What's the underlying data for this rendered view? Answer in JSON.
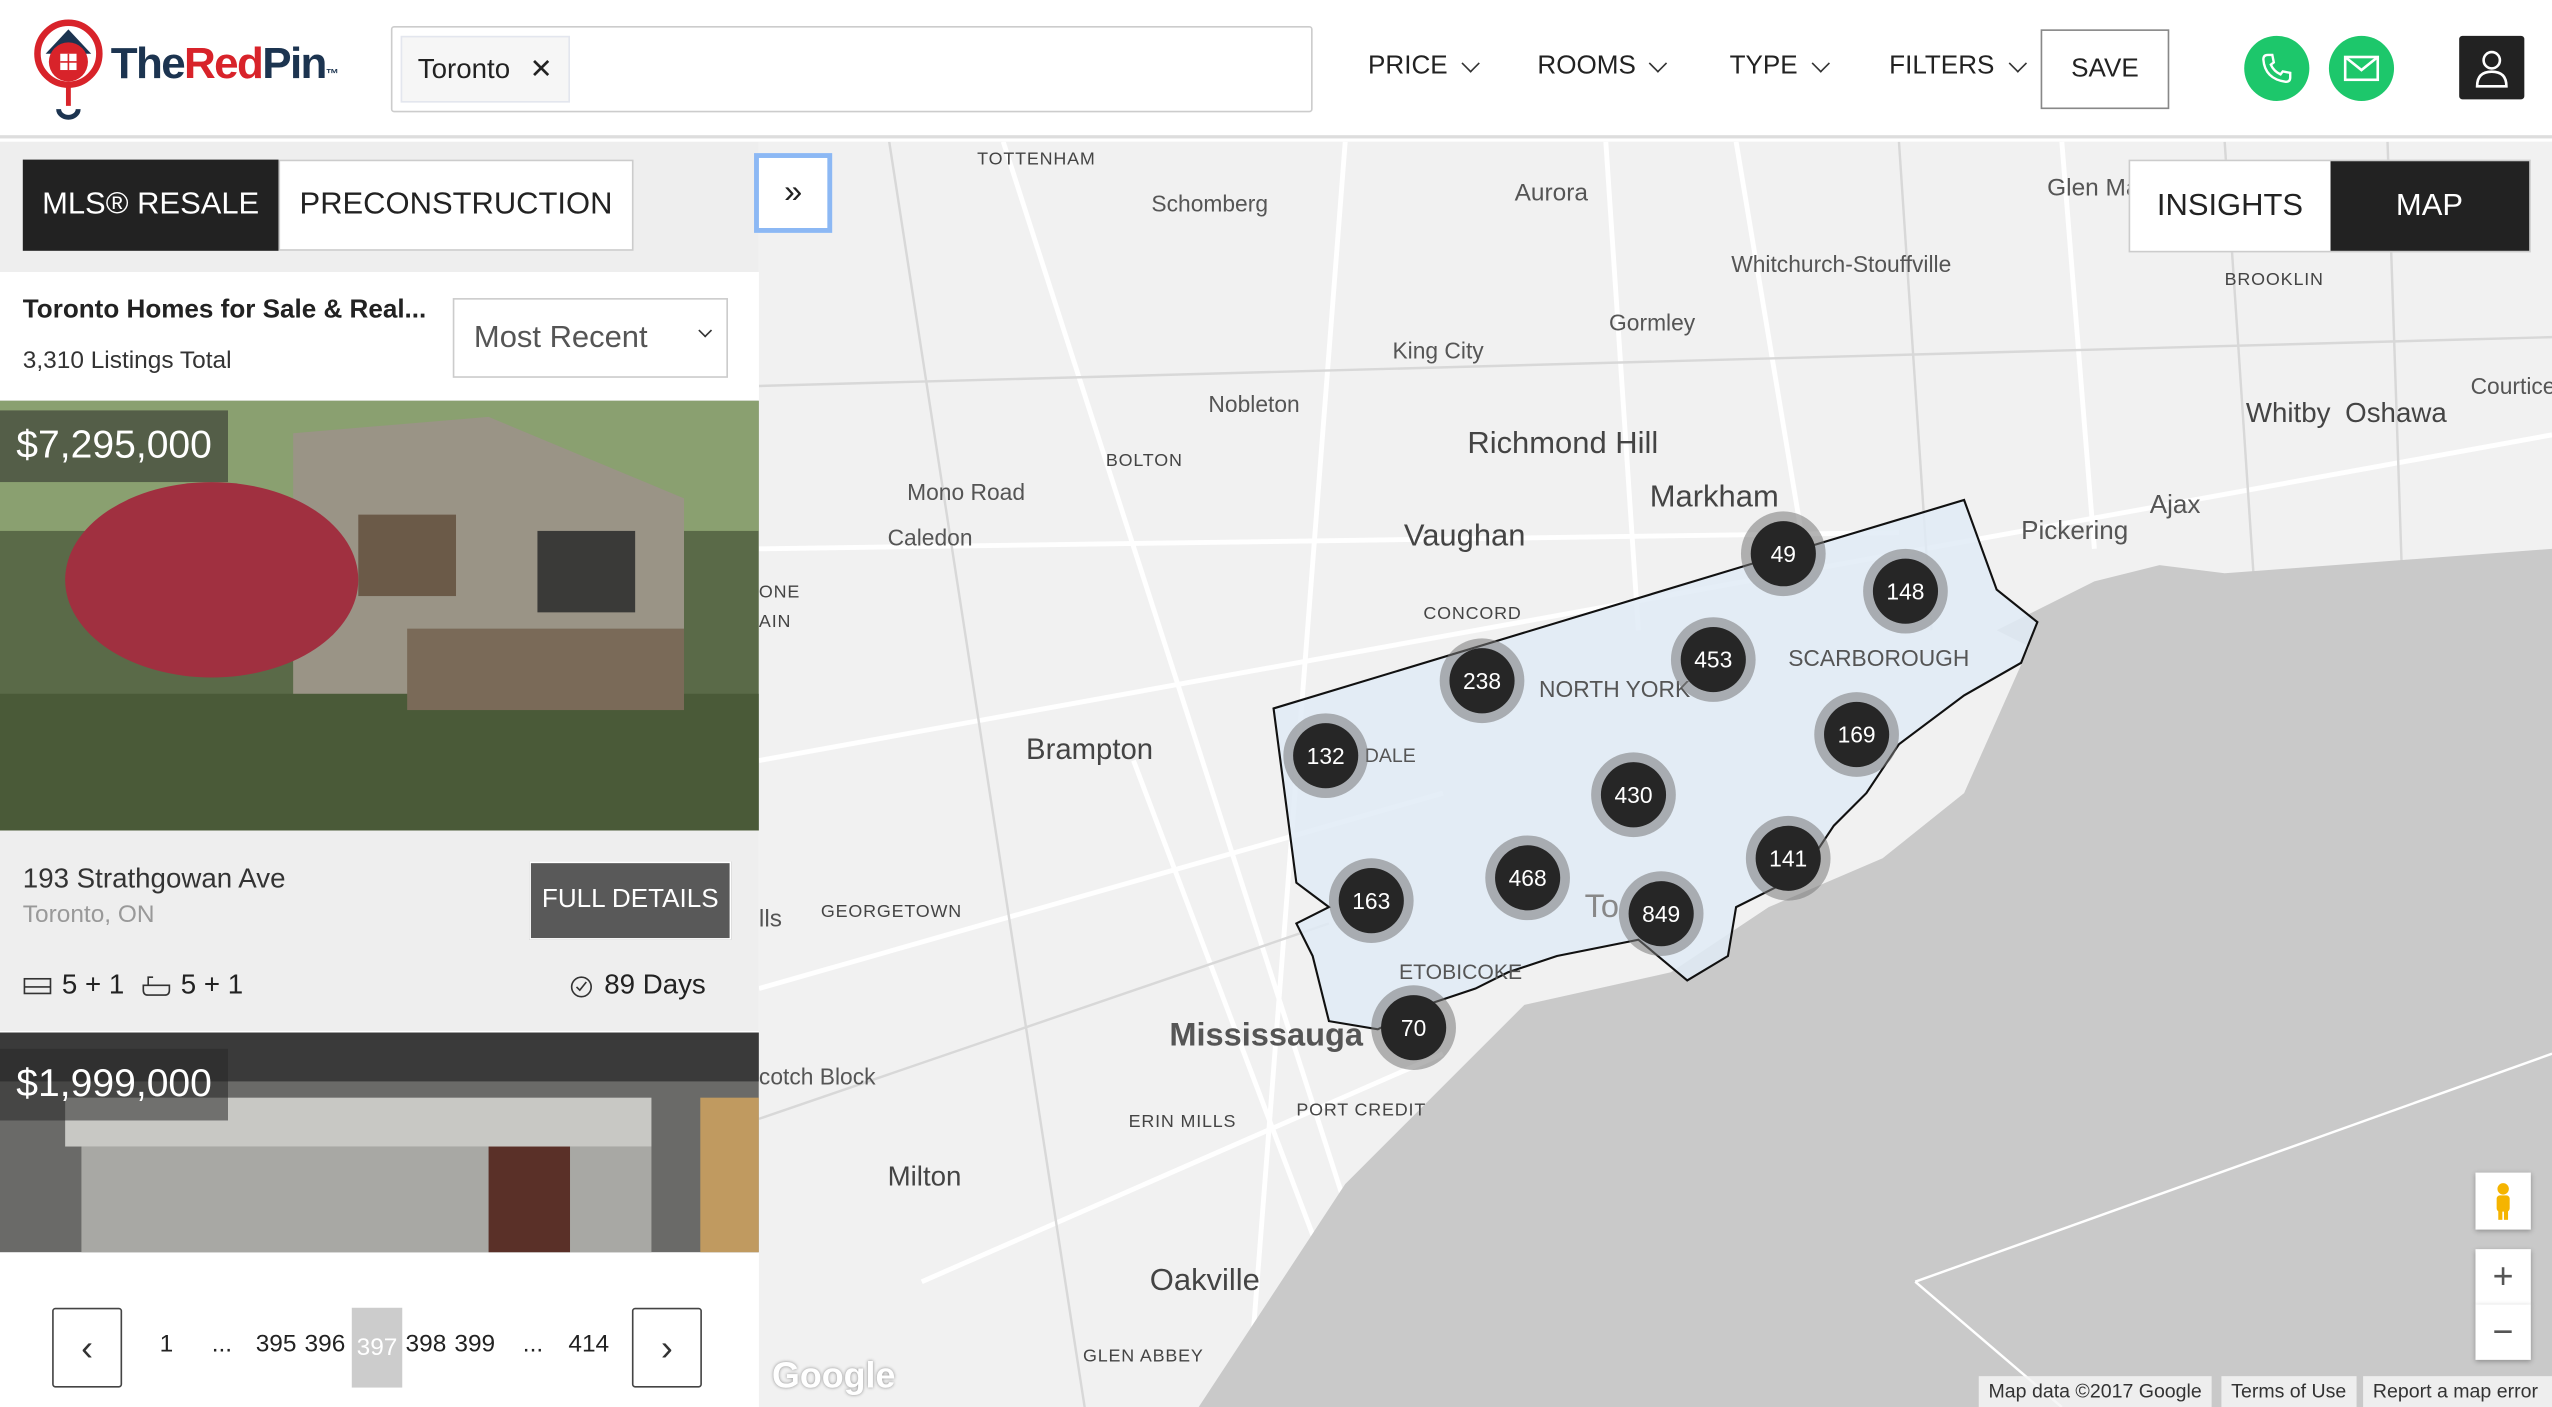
{
  "brand": {
    "logo_text_dark_1": "The",
    "logo_text_red": "Red",
    "logo_text_dark_2": "Pin",
    "trademark": "™"
  },
  "search": {
    "chip_label": "Toronto",
    "chip_remove": "✕"
  },
  "nav": {
    "price": "PRICE",
    "rooms": "ROOMS",
    "type": "TYPE",
    "filters": "FILTERS",
    "save": "SAVE"
  },
  "colors": {
    "brand_red": "#d8232a",
    "brand_navy": "#1c3450",
    "contact_green": "#1dc76b",
    "toronto_fill": "#e1ebf6"
  },
  "listing_tabs": {
    "resale": "MLS® RESALE",
    "preconstruction": "PRECONSTRUCTION",
    "active": "resale"
  },
  "results": {
    "title": "Toronto Homes for Sale & Real...",
    "count": "3,310 Listings Total",
    "sort_selected": "Most Recent"
  },
  "listings": [
    {
      "price": "$7,295,000",
      "address": "193 Strathgowan Ave",
      "city": "Toronto, ON",
      "beds": "5 + 1",
      "baths": "5 + 1",
      "days": "89 Days",
      "details_button": "FULL DETAILS"
    },
    {
      "price": "$1,999,000"
    }
  ],
  "pagination": {
    "pages": [
      "1",
      "...",
      "395",
      "396",
      "397",
      "398",
      "399",
      "...",
      "414"
    ],
    "current": "397",
    "prev": "‹",
    "next": "›"
  },
  "map_view": {
    "insights": "INSIGHTS",
    "map": "MAP",
    "active": "map",
    "collapse": "»",
    "zoom_in": "+",
    "zoom_out": "−"
  },
  "map_labels": [
    "TOTTENHAM",
    "Schomberg",
    "Aurora",
    "Glen Ma",
    "Whitchurch-Stouffville",
    "BROOKLIN",
    "Gormley",
    "King City",
    "Courtice",
    "Nobleton",
    "Richmond Hill",
    "Whitby",
    "Oshawa",
    "BOLTON",
    "Mono Road",
    "Markham",
    "Ajax",
    "Caledon",
    "Vaughan",
    "Pickering",
    "CONCORD",
    "NORTH YORK",
    "SCARBOROUGH",
    "Brampton",
    "GEORGETOWN",
    "ETOBICOKE",
    "Mississauga",
    "PORT CREDIT",
    "ERIN MILLS",
    "Milton",
    "Oakville",
    "GLEN ABBEY",
    "DALE",
    "ONE",
    "AIN",
    "lls",
    "cotch Block",
    "To"
  ],
  "clusters": [
    "49",
    "148",
    "453",
    "238",
    "169",
    "132",
    "430",
    "141",
    "468",
    "849",
    "163",
    "70"
  ],
  "attribution": {
    "google": "Google",
    "map_data": "Map data ©2017 Google",
    "terms": "Terms of Use",
    "report": "Report a map error"
  }
}
